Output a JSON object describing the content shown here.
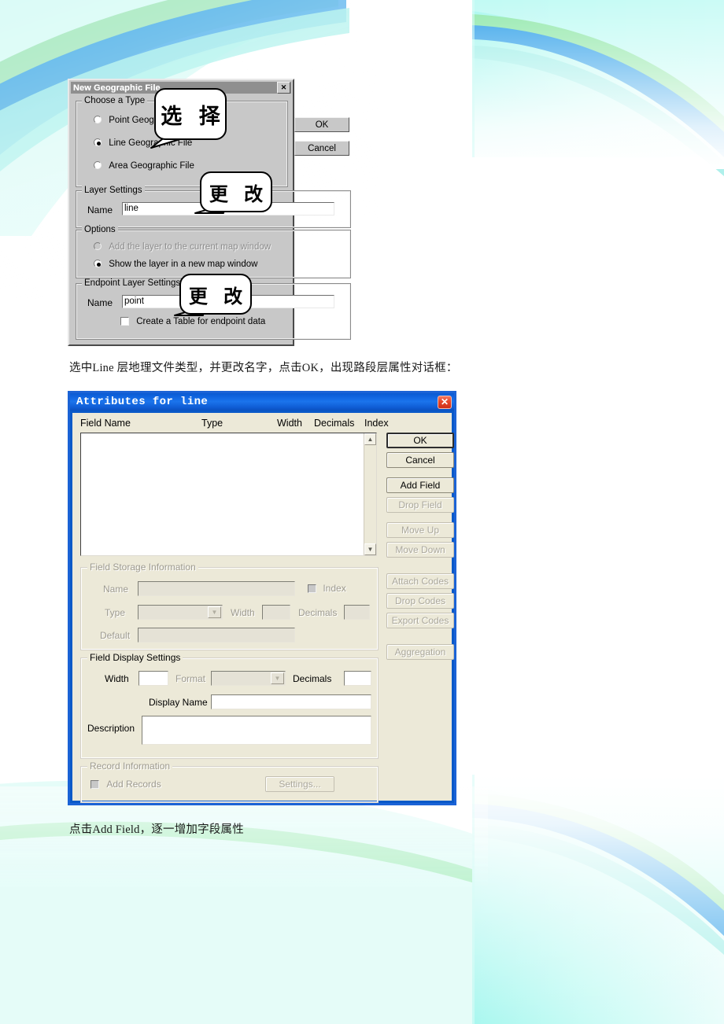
{
  "document": {
    "caption_middle": "选中Line 层地理文件类型，并更改名字，点击OK，出现路段层属性对话框：",
    "caption_bottom": "点击Add Field，逐一增加字段属性"
  },
  "callouts": [
    {
      "text": "选 择"
    },
    {
      "text": "更 改"
    },
    {
      "text": "更 改"
    }
  ],
  "dialog1": {
    "title": "New Geographic File",
    "close_label": "✕",
    "group_type": {
      "legend": "Choose a Type",
      "options": [
        {
          "label": "Point Geographic File",
          "selected": false,
          "enabled": true
        },
        {
          "label": "Line Geographic File",
          "selected": true,
          "enabled": true
        },
        {
          "label": "Area Geographic File",
          "selected": false,
          "enabled": true
        }
      ]
    },
    "buttons": {
      "ok": "OK",
      "cancel": "Cancel"
    },
    "group_layer": {
      "legend": "Layer Settings",
      "name_label": "Name",
      "name_value": "line"
    },
    "group_options": {
      "legend": "Options",
      "options": [
        {
          "label": "Add the layer to the current map window",
          "selected": false,
          "enabled": false
        },
        {
          "label": "Show the layer in a new map window",
          "selected": true,
          "enabled": true
        }
      ]
    },
    "group_endpoint": {
      "legend": "Endpoint Layer Settings",
      "name_label": "Name",
      "name_value": "point",
      "checkbox_label": "Create a Table for endpoint data",
      "checkbox_checked": false
    }
  },
  "dialog2": {
    "title": "Attributes for line",
    "close_label": "✕",
    "columns": [
      "Field Name",
      "Type",
      "Width",
      "Decimals",
      "Index"
    ],
    "rows": [],
    "scrollbar": {
      "up": "▲",
      "down": "▼"
    },
    "buttons": [
      {
        "label": "OK",
        "enabled": true,
        "default": true
      },
      {
        "label": "Cancel",
        "enabled": true,
        "default": false
      },
      {
        "label": "Add Field",
        "enabled": true,
        "default": false
      },
      {
        "label": "Drop Field",
        "enabled": false,
        "default": false
      },
      {
        "label": "Move Up",
        "enabled": false,
        "default": false
      },
      {
        "label": "Move Down",
        "enabled": false,
        "default": false
      },
      {
        "label": "Attach Codes",
        "enabled": false,
        "default": false
      },
      {
        "label": "Drop Codes",
        "enabled": false,
        "default": false
      },
      {
        "label": "Export Codes",
        "enabled": false,
        "default": false
      },
      {
        "label": "Aggregation",
        "enabled": false,
        "default": false
      }
    ],
    "storage": {
      "legend": "Field Storage Information",
      "name_label": "Name",
      "name_value": "",
      "index_label": "Index",
      "index_checked": false,
      "type_label": "Type",
      "type_value": "",
      "width_label": "Width",
      "width_value": "",
      "decimals_label": "Decimals",
      "decimals_value": "",
      "default_label": "Default",
      "default_value": ""
    },
    "display": {
      "legend": "Field Display Settings",
      "width_label": "Width",
      "width_value": "",
      "format_label": "Format",
      "format_value": "",
      "decimals_label": "Decimals",
      "decimals_value": "",
      "display_name_label": "Display Name",
      "display_name_value": "",
      "description_label": "Description",
      "description_value": ""
    },
    "record": {
      "legend": "Record Information",
      "add_records_label": "Add Records",
      "add_records_checked": false,
      "settings_label": "Settings..."
    }
  },
  "theme": {
    "xp_title_blue": "#1b74ec",
    "xp_face": "#ece9d8",
    "win9x_face": "#c8c8c8",
    "wave_blue": "#3aa5ea",
    "wave_green": "#7fe39a",
    "wave_cyan": "#9df3ef"
  }
}
